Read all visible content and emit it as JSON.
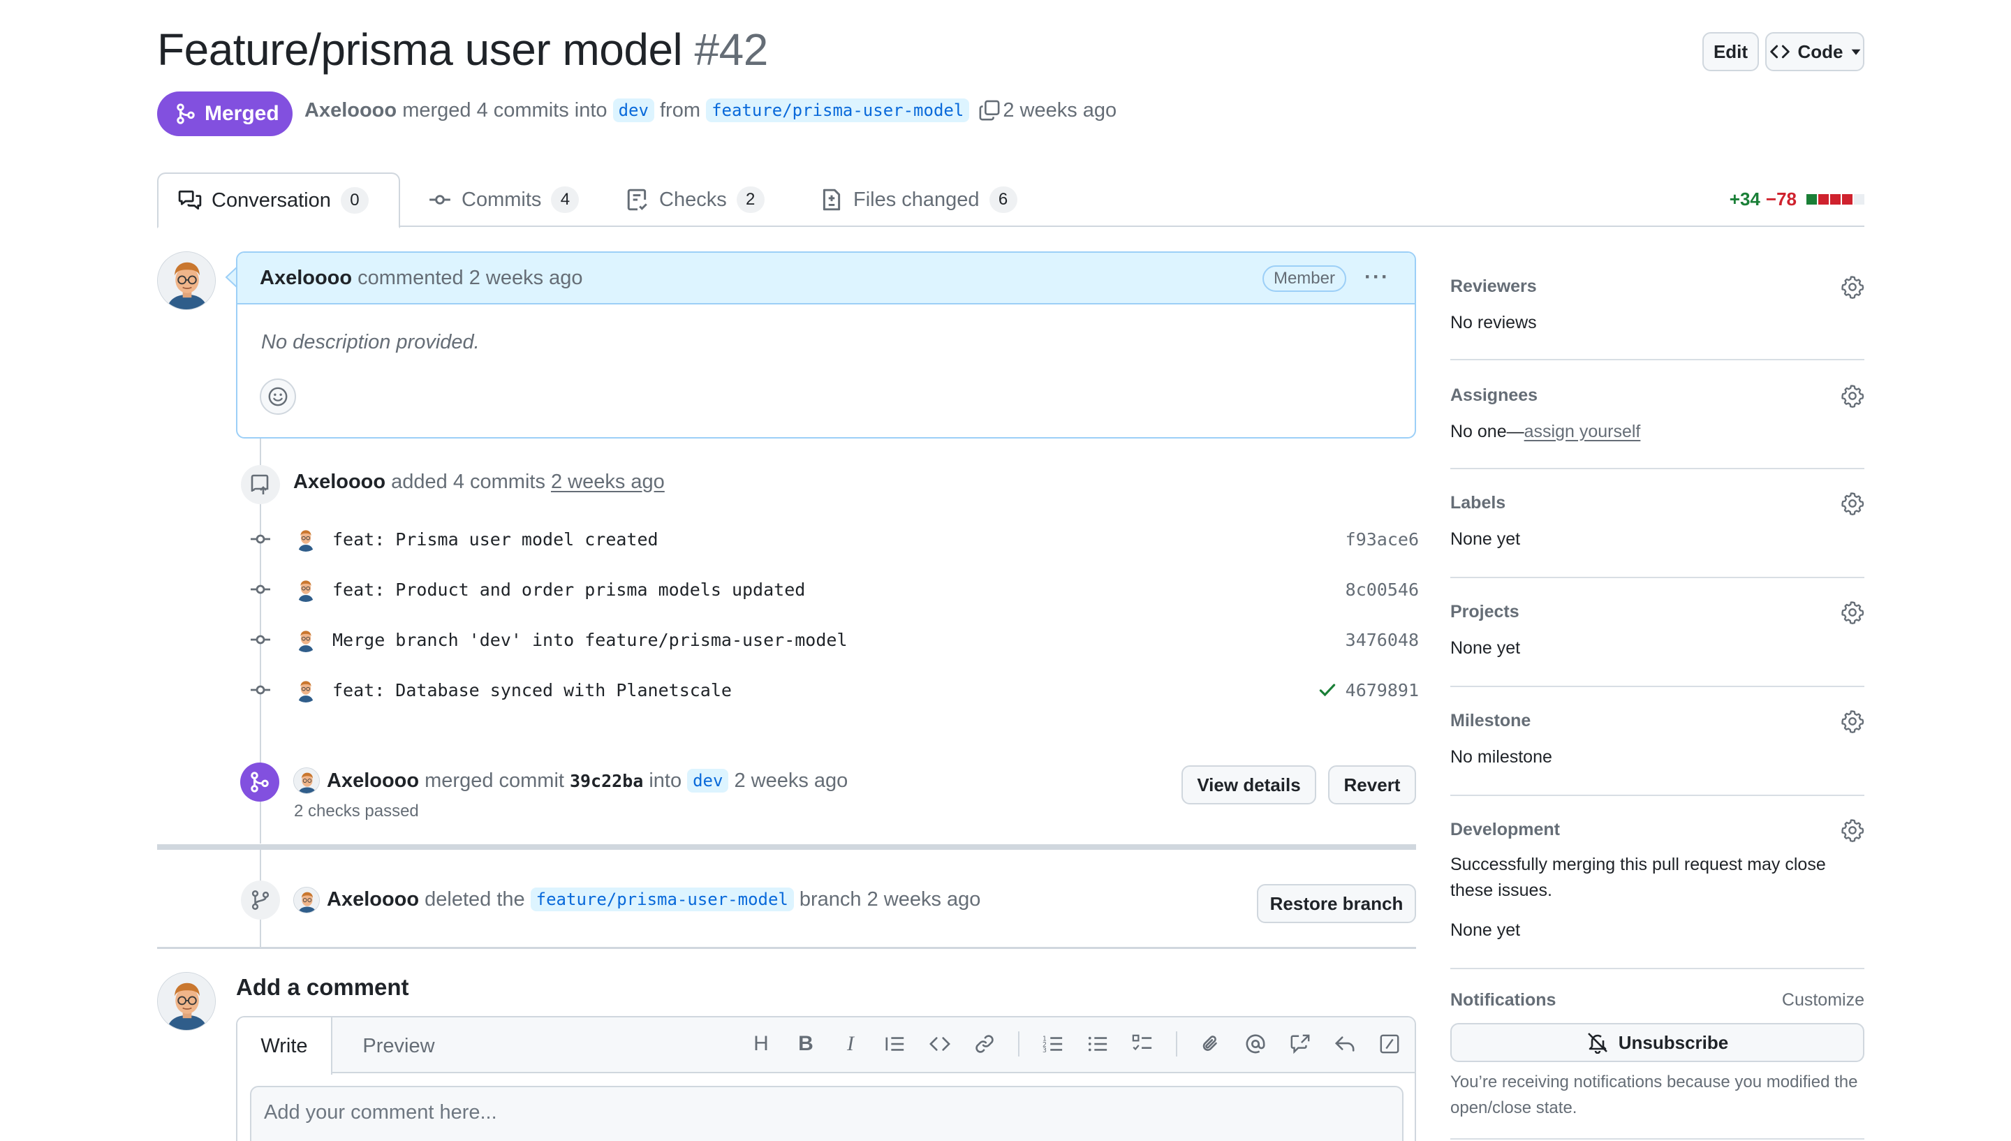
{
  "header": {
    "title": "Feature/prisma user model",
    "number": "#42",
    "edit_label": "Edit",
    "code_label": "Code",
    "state_label": "Merged",
    "author": "Axeloooo",
    "merged_text": "merged 4 commits into",
    "base_branch": "dev",
    "from_text": "from",
    "head_branch": "feature/prisma-user-model",
    "time": "2 weeks ago"
  },
  "tabs": [
    {
      "label": "Conversation",
      "count": "0"
    },
    {
      "label": "Commits",
      "count": "4"
    },
    {
      "label": "Checks",
      "count": "2"
    },
    {
      "label": "Files changed",
      "count": "6"
    }
  ],
  "diffstat": {
    "additions": "+34",
    "deletions": "−78"
  },
  "comment": {
    "author": "Axeloooo",
    "action": "commented 2 weeks ago",
    "role": "Member",
    "body": "No description provided."
  },
  "commits_event": {
    "author": "Axeloooo",
    "text": "added 4 commits",
    "time": "2 weeks ago"
  },
  "commits": [
    {
      "message": "feat: Prisma user model created",
      "sha": "f93ace6",
      "check": false
    },
    {
      "message": "feat: Product and order prisma models updated",
      "sha": "8c00546",
      "check": false
    },
    {
      "message": "Merge branch 'dev' into feature/prisma-user-model",
      "sha": "3476048",
      "check": false
    },
    {
      "message": "feat: Database synced with Planetscale",
      "sha": "4679891",
      "check": true
    }
  ],
  "merge_event": {
    "author": "Axeloooo",
    "text": "merged commit",
    "sha": "39c22ba",
    "into": "into",
    "branch": "dev",
    "time": "2 weeks ago",
    "checks": "2 checks passed",
    "view_details_label": "View details",
    "revert_label": "Revert"
  },
  "delete_event": {
    "author": "Axeloooo",
    "text": "deleted the",
    "branch": "feature/prisma-user-model",
    "suffix": "branch 2 weeks ago",
    "restore_label": "Restore branch"
  },
  "add_comment": {
    "title": "Add a comment",
    "write_tab": "Write",
    "preview_tab": "Preview",
    "placeholder": "Add your comment here..."
  },
  "sidebar": {
    "reviewers": {
      "title": "Reviewers",
      "value": "No reviews"
    },
    "assignees": {
      "title": "Assignees",
      "prefix": "No one—",
      "link": "assign yourself"
    },
    "labels": {
      "title": "Labels",
      "value": "None yet"
    },
    "projects": {
      "title": "Projects",
      "value": "None yet"
    },
    "milestone": {
      "title": "Milestone",
      "value": "No milestone"
    },
    "development": {
      "title": "Development",
      "text": "Successfully merging this pull request may close these issues.",
      "value": "None yet"
    },
    "notifications": {
      "title": "Notifications",
      "customize": "Customize",
      "unsubscribe": "Unsubscribe",
      "reason": "You’re receiving notifications because you modified the open/close state."
    }
  },
  "colors": {
    "accent_purple": "#8250df",
    "link_blue": "#0969da",
    "add_green": "#1a7f37",
    "del_red": "#cf222e",
    "border": "#d0d7de"
  }
}
